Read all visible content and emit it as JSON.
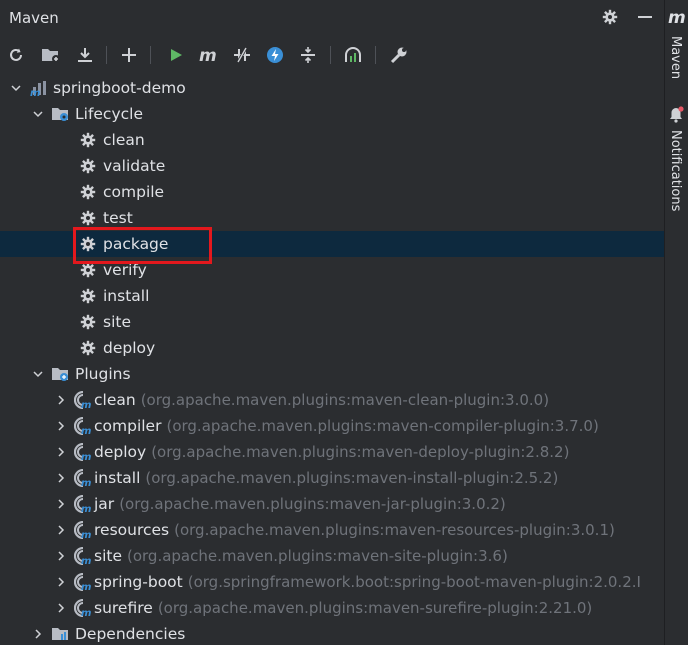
{
  "window": {
    "title": "Maven"
  },
  "toolbar": {
    "icons": [
      "reload-icon",
      "add-folder-icon",
      "download-icon",
      "plus-icon",
      "run-icon",
      "maven-goal-icon",
      "toggle-offline-icon",
      "lightning-icon",
      "collapse-icon",
      "show-dependencies-icon",
      "settings-wrench-icon"
    ]
  },
  "tree": {
    "project": "springboot-demo",
    "lifecycle": {
      "label": "Lifecycle",
      "goals": [
        "clean",
        "validate",
        "compile",
        "test",
        "package",
        "verify",
        "install",
        "site",
        "deploy"
      ],
      "selected": "package"
    },
    "plugins": {
      "label": "Plugins",
      "items": [
        {
          "name": "clean",
          "detail": "(org.apache.maven.plugins:maven-clean-plugin:3.0.0)"
        },
        {
          "name": "compiler",
          "detail": "(org.apache.maven.plugins:maven-compiler-plugin:3.7.0)"
        },
        {
          "name": "deploy",
          "detail": "(org.apache.maven.plugins:maven-deploy-plugin:2.8.2)"
        },
        {
          "name": "install",
          "detail": "(org.apache.maven.plugins:maven-install-plugin:2.5.2)"
        },
        {
          "name": "jar",
          "detail": "(org.apache.maven.plugins:maven-jar-plugin:3.0.2)"
        },
        {
          "name": "resources",
          "detail": "(org.apache.maven.plugins:maven-resources-plugin:3.0.1)"
        },
        {
          "name": "site",
          "detail": "(org.apache.maven.plugins:maven-site-plugin:3.6)"
        },
        {
          "name": "spring-boot",
          "detail": "(org.springframework.boot:spring-boot-maven-plugin:2.0.2.I"
        },
        {
          "name": "surefire",
          "detail": "(org.apache.maven.plugins:maven-surefire-plugin:2.21.0)"
        }
      ]
    },
    "dependencies": {
      "label": "Dependencies"
    }
  },
  "rightbar": {
    "maven_logo": "m",
    "maven_tab": "Maven",
    "notifications_tab": "Notifications"
  },
  "colors": {
    "background": "#2b2d30",
    "selection": "#0d293e",
    "highlight_box": "#e3181d",
    "run_green": "#5fb865",
    "detail_text": "#6f737a"
  }
}
